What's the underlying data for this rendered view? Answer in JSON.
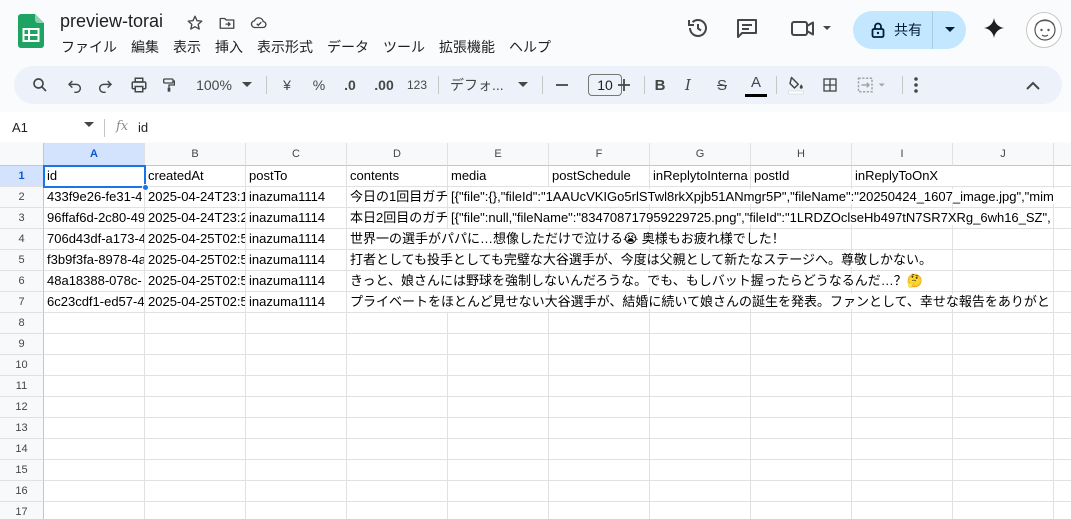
{
  "doc": {
    "title": "preview-torai"
  },
  "menu": [
    "ファイル",
    "編集",
    "表示",
    "挿入",
    "表示形式",
    "データ",
    "ツール",
    "拡張機能",
    "ヘルプ"
  ],
  "share": {
    "label": "共有"
  },
  "toolbar": {
    "zoom": "100%",
    "currency": "¥",
    "percent": "%",
    "decrease_decimal": ".0",
    "increase_decimal": ".00",
    "number_format": "123",
    "font": "デフォ...",
    "font_size": "10",
    "bold": "B",
    "italic": "I",
    "strike": "S",
    "text_color": "A"
  },
  "formula": {
    "cell_ref": "A1",
    "fx": "fx",
    "content": "id"
  },
  "columns": [
    "A",
    "B",
    "C",
    "D",
    "E",
    "F",
    "G",
    "H",
    "I",
    "J"
  ],
  "rows": [
    "1",
    "2",
    "3",
    "4",
    "5",
    "6",
    "7",
    "8",
    "9",
    "10",
    "11",
    "12",
    "13",
    "14",
    "15",
    "16",
    "17"
  ],
  "cells": {
    "r1": [
      "id",
      "createdAt",
      "postTo",
      "contents",
      "media",
      "postSchedule",
      "inReplytoInterna",
      "postId",
      "inReplyToOnX",
      ""
    ],
    "r2": [
      "433f9e26-fe31-4",
      "2025-04-24T23:1",
      "inazuma1114",
      "今日の1回目ガチ",
      "[{\"file\":{},\"fileId\":\"1AAUcVKIGo5rlSTwl8rkXpjb51ANmgr5P\",\"fileName\":\"20250424_1607_image.jpg\",\"mim",
      "",
      "",
      "",
      "",
      ""
    ],
    "r3": [
      "96ffaf6d-2c80-49",
      "2025-04-24T23:2",
      "inazuma1114",
      "本日2回目のガチ",
      "[{\"file\":null,\"fileName\":\"834708717959229725.png\",\"fileId\":\"1LRDZOclseHb497tN7SR7XRg_6wh16_SZ\",",
      "",
      "",
      "",
      "",
      ""
    ],
    "r4": [
      "706d43df-a173-4",
      "2025-04-25T02:5",
      "inazuma1114",
      "世界一の選手がパパに…想像しただけで泣ける😭 奥様もお疲れ様でした！",
      "",
      "",
      "",
      "",
      "",
      ""
    ],
    "r5": [
      "f3b9f3fa-8978-4a",
      "2025-04-25T02:5",
      "inazuma1114",
      "打者としても投手としても完璧な大谷選手が、今度は父親として新たなステージへ。尊敬しかない。",
      "",
      "",
      "",
      "",
      "",
      ""
    ],
    "r6": [
      "48a18388-078c-",
      "2025-04-25T02:5",
      "inazuma1114",
      "きっと、娘さんには野球を強制しないんだろうな。でも、もしバット握ったらどうなるんだ…？🤔",
      "",
      "",
      "",
      "",
      "",
      ""
    ],
    "r7": [
      "6c23cdf1-ed57-4",
      "2025-04-25T02:5",
      "inazuma1114",
      "プライベートをほとんど見せない大谷選手が、結婚に続いて娘さんの誕生を発表。ファンとして、幸せな報告をありがと",
      "",
      "",
      "",
      "",
      "",
      ""
    ]
  },
  "icons": {
    "logo": "sheets-logo-icon",
    "star": "star-icon",
    "move": "move-to-folder-icon",
    "cloud": "cloud-status-icon",
    "history": "version-history-icon",
    "comment": "comment-icon",
    "meet": "video-call-icon",
    "gemini": "gemini-spark-icon"
  },
  "colors": {
    "accent": "#1a73e8",
    "share_bg": "#c2e7ff",
    "sheets_green": "#1ea362"
  }
}
